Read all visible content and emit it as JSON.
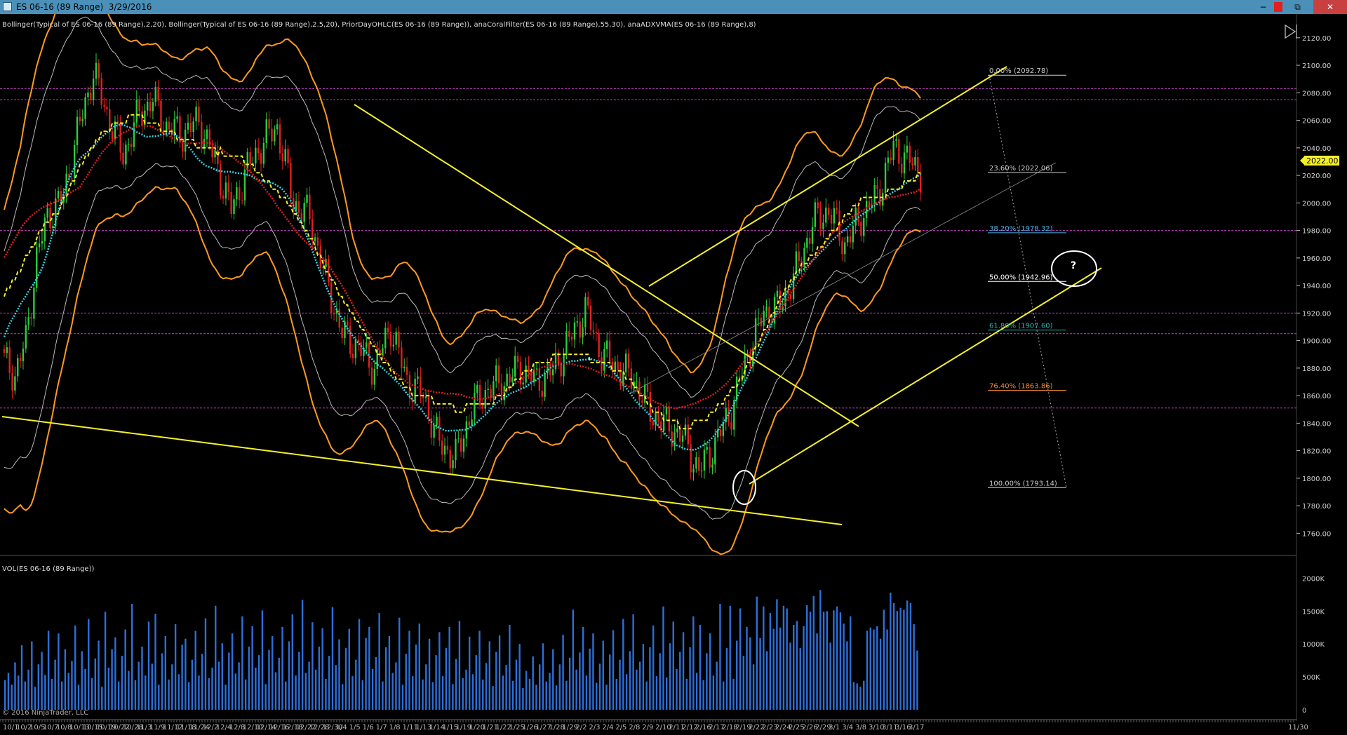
{
  "window": {
    "title": "ES 06-16 (89 Range)  3/29/2016",
    "min_label": "−",
    "restore_label": "⧉",
    "close_label": "✕"
  },
  "indicators_label": "Bollinger(Typical of ES 06-16 (89 Range),2,20), Bollinger(Typical of ES 06-16 (89 Range),2.5,20), PriorDayOHLC(ES 06-16 (89 Range)), anaCoralFilter(ES 06-16 (89 Range),55,30), anaADXVMA(ES 06-16 (89 Range),8)",
  "volume_label": "VOL(ES 06-16 (89 Range))",
  "copyright": "© 2016 NinjaTrader, LLC",
  "current_price": "2022.00",
  "question_mark": "?",
  "colors": {
    "background": "#000000",
    "titlebar": "#4a90b8",
    "up": "#2ecc40",
    "down": "#e02020",
    "bollinger": "#ff9a1e",
    "trendline": "#f5f02a",
    "volume": "#2d6fd8",
    "level": "#c040c0"
  },
  "chart_data": {
    "type": "candlestick",
    "y_axis": {
      "min": 1750,
      "max": 2125,
      "ticks": [
        "2120.00",
        "2100.00",
        "2080.00",
        "2060.00",
        "2040.00",
        "2020.00",
        "2000.00",
        "1980.00",
        "1960.00",
        "1940.00",
        "1920.00",
        "1900.00",
        "1880.00",
        "1860.00",
        "1840.00",
        "1820.00",
        "1800.00",
        "1780.00",
        "1760.00"
      ]
    },
    "volume_axis": {
      "min": 0,
      "max": 2100,
      "ticks": [
        "2000K",
        "1500K",
        "1000K",
        "500K",
        "0"
      ]
    },
    "x_labels": [
      "10/1",
      "10/2",
      "10/5",
      "10/7",
      "10/8",
      "10/13",
      "10/15",
      "10/19",
      "10/22",
      "10/28",
      "11/3",
      "11/9",
      "11/12",
      "11/18",
      "11/24",
      "12/2",
      "12/4",
      "12/8",
      "12/10",
      "12/14",
      "12/16",
      "12/18",
      "12/22",
      "12/28",
      "12/30",
      "1/4",
      "1/5",
      "1/6",
      "1/7",
      "1/8",
      "1/11",
      "1/13",
      "1/14",
      "1/15",
      "1/19",
      "1/20",
      "1/21",
      "1/22",
      "1/25",
      "1/26",
      "1/27",
      "1/28",
      "1/29",
      "2/2",
      "2/3",
      "2/4",
      "2/5",
      "2/8",
      "2/9",
      "2/10",
      "2/11",
      "2/12",
      "2/16",
      "2/17",
      "2/18",
      "2/19",
      "2/22",
      "2/23",
      "2/24",
      "2/25",
      "2/26",
      "2/29",
      "3/1",
      "3/4",
      "3/8",
      "3/10",
      "3/11",
      "3/16",
      "3/17",
      "11/30"
    ],
    "horizontal_levels": [
      2083,
      2075,
      1980,
      1920,
      1905,
      1851
    ],
    "fibonacci": [
      {
        "label": "0.00% (2092.78)",
        "price": 2092.78,
        "color": "#cccccc"
      },
      {
        "label": "23.60% (2022.06)",
        "price": 2022.06,
        "color": "#cccccc"
      },
      {
        "label": "38.20% (1978.32)",
        "price": 1978.32,
        "color": "#4fb4e8"
      },
      {
        "label": "50.00% (1942.96)",
        "price": 1942.96,
        "color": "#ffffff"
      },
      {
        "label": "61.80% (1907.60)",
        "price": 1907.6,
        "color": "#2ab5b5"
      },
      {
        "label": "76.40% (1863.86)",
        "price": 1863.86,
        "color": "#f08a30"
      },
      {
        "label": "100.00% (1793.14)",
        "price": 1793.14,
        "color": "#cccccc"
      }
    ],
    "close_path": [
      [
        0,
        1885
      ],
      [
        4,
        1875
      ],
      [
        8,
        1900
      ],
      [
        12,
        1960
      ],
      [
        16,
        1990
      ],
      [
        22,
        2005
      ],
      [
        27,
        2050
      ],
      [
        33,
        2095
      ],
      [
        38,
        2065
      ],
      [
        44,
        2035
      ],
      [
        50,
        2065
      ],
      [
        55,
        2075
      ],
      [
        60,
        2055
      ],
      [
        66,
        2050
      ],
      [
        72,
        2060
      ],
      [
        78,
        2030
      ],
      [
        84,
        1995
      ],
      [
        90,
        2025
      ],
      [
        96,
        2045
      ],
      [
        101,
        2055
      ],
      [
        107,
        2000
      ],
      [
        113,
        1990
      ],
      [
        119,
        1945
      ],
      [
        125,
        1905
      ],
      [
        131,
        1895
      ],
      [
        137,
        1880
      ],
      [
        143,
        1910
      ],
      [
        149,
        1870
      ],
      [
        155,
        1860
      ],
      [
        161,
        1825
      ],
      [
        167,
        1815
      ],
      [
        173,
        1850
      ],
      [
        179,
        1865
      ],
      [
        185,
        1870
      ],
      [
        191,
        1880
      ],
      [
        197,
        1870
      ],
      [
        203,
        1878
      ],
      [
        209,
        1900
      ],
      [
        215,
        1922
      ],
      [
        221,
        1890
      ],
      [
        227,
        1880
      ],
      [
        233,
        1872
      ],
      [
        239,
        1848
      ],
      [
        245,
        1838
      ],
      [
        251,
        1830
      ],
      [
        257,
        1805
      ],
      [
        263,
        1825
      ],
      [
        269,
        1850
      ],
      [
        275,
        1890
      ],
      [
        281,
        1920
      ],
      [
        287,
        1925
      ],
      [
        293,
        1950
      ],
      [
        299,
        1985
      ],
      [
        305,
        1995
      ],
      [
        311,
        1970
      ],
      [
        317,
        1990
      ],
      [
        323,
        2005
      ],
      [
        329,
        2040
      ],
      [
        335,
        2030
      ],
      [
        339,
        2022
      ]
    ],
    "volumes": [
      450,
      560,
      380,
      720,
      520,
      980,
      430,
      610,
      1040,
      350,
      690,
      880,
      530,
      1200,
      470,
      760,
      1160,
      430,
      920,
      560,
      740,
      1280,
      380,
      890,
      620,
      1380,
      480,
      780,
      1050,
      350,
      1490,
      640,
      920,
      1100,
      430,
      820,
      1220,
      590,
      1610,
      450,
      730,
      960,
      520,
      1340,
      700,
      1460,
      380,
      860,
      1120,
      460,
      690,
      1300,
      540,
      990,
      1080,
      420,
      760,
      1200,
      520,
      850,
      1390,
      480,
      640,
      1580,
      730,
      1010,
      380,
      870,
      1160,
      550,
      720,
      1420,
      460,
      960,
      1270,
      640,
      830,
      1510,
      390,
      910,
      1120,
      570,
      790,
      1260,
      430,
      1040,
      1450,
      520,
      880,
      1670,
      560,
      730,
      1330,
      610,
      960,
      1240,
      470,
      820,
      1560,
      680,
      1070,
      390,
      940,
      1230,
      510,
      760,
      1380,
      450,
      1090,
      1260,
      620,
      800,
      1470,
      430,
      950,
      1120,
      560,
      720,
      1400,
      380,
      850,
      1200,
      510,
      990,
      1310,
      460,
      690,
      1080,
      420,
      830,
      1180,
      510,
      940,
      1260,
      390,
      770,
      1350,
      480,
      610,
      1110,
      540,
      830,
      1200,
      460,
      710,
      1040,
      360,
      880,
      1130,
      520,
      680,
      1290,
      440,
      760,
      1000,
      330,
      590,
      470,
      810,
      380,
      690,
      1010,
      430,
      560,
      920,
      370,
      690,
      1140,
      440,
      790,
      1520,
      610,
      870,
      1260,
      520,
      930,
      1160,
      410,
      700,
      1050,
      380,
      840,
      1210,
      470,
      760,
      1380,
      540,
      890,
      1450,
      610,
      730,
      1000,
      430,
      950,
      1280,
      510,
      860,
      1570,
      490,
      1010,
      1340,
      620,
      880,
      1180,
      470,
      950,
      1420,
      560,
      1290,
      450,
      860,
      1160,
      520,
      730,
      1610,
      430,
      940,
      1580,
      470,
      1050,
      1540,
      820,
      1260,
      1100,
      690,
      1720,
      1090,
      1570,
      890,
      1470,
      1230,
      1680,
      1250,
      1580,
      1540,
      1020,
      1290,
      1350,
      940,
      1270,
      1590,
      1490,
      1730,
      1160,
      1820,
      1490,
      1500,
      1020,
      1510,
      1570,
      1480,
      1310,
      1040,
      1420,
      420,
      400,
      350,
      440,
      1200,
      1250,
      1220,
      1270,
      1080,
      1520,
      1220,
      1780,
      1620,
      1500,
      1550,
      1520,
      1660,
      1620,
      1300,
      900
    ]
  }
}
